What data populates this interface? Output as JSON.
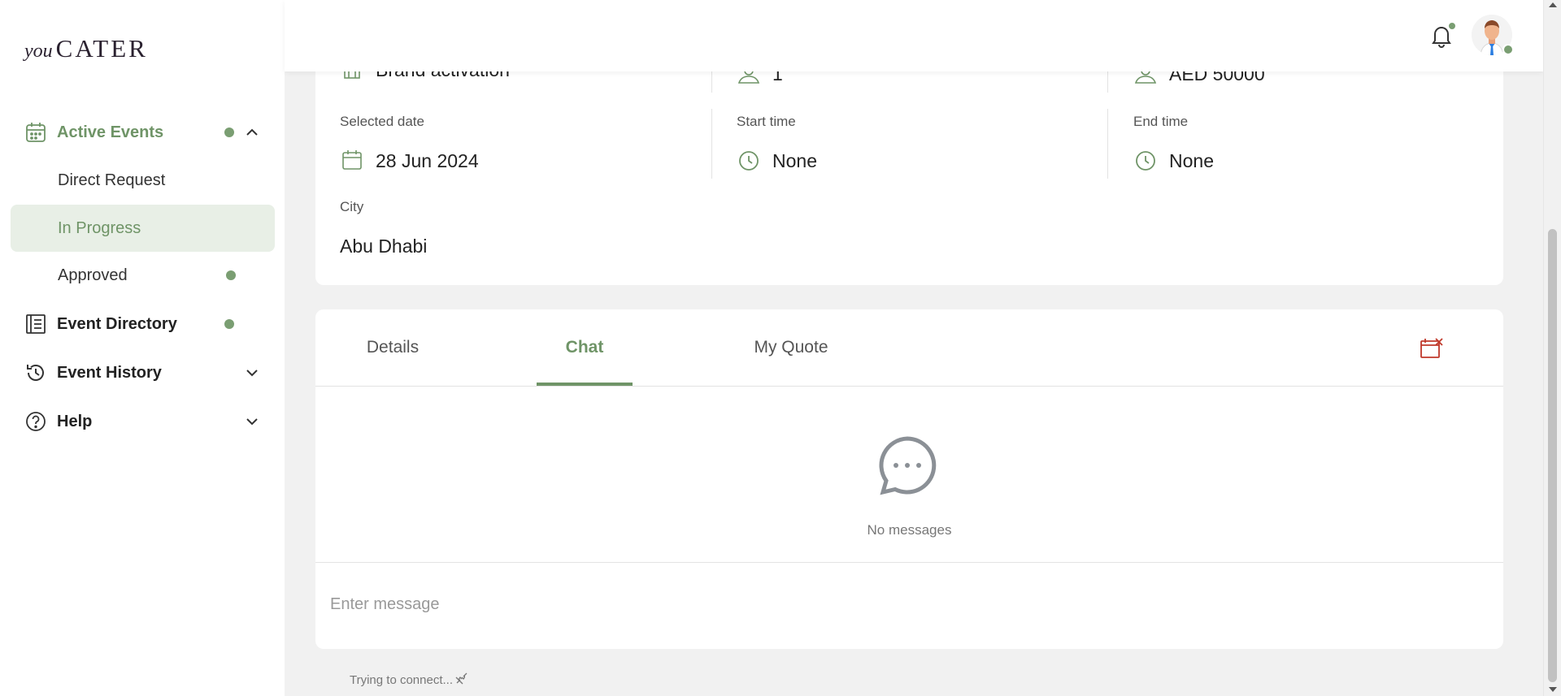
{
  "brand": {
    "prefix": "you",
    "name": "CATER"
  },
  "colors": {
    "accent": "#6f9467",
    "dot": "#7a9e72",
    "danger": "#c0392b",
    "selected_bg": "#e8efe6"
  },
  "sidebar": {
    "active_events": {
      "label": "Active Events",
      "icon": "calendar-icon"
    },
    "sub_items": [
      {
        "label": "Direct Request"
      },
      {
        "label": "In Progress"
      },
      {
        "label": "Approved"
      }
    ],
    "event_directory": {
      "label": "Event Directory",
      "icon": "directory-icon"
    },
    "event_history": {
      "label": "Event History",
      "icon": "history-icon"
    },
    "help": {
      "label": "Help",
      "icon": "help-icon"
    }
  },
  "event_info": {
    "event_type": {
      "value": "Brand activation"
    },
    "guests": {
      "value": "1"
    },
    "budget": {
      "value": "AED 50000"
    },
    "selected_date": {
      "label": "Selected date",
      "value": "28 Jun 2024"
    },
    "start_time": {
      "label": "Start time",
      "value": "None"
    },
    "end_time": {
      "label": "End time",
      "value": "None"
    },
    "city": {
      "label": "City",
      "value": "Abu Dhabi"
    }
  },
  "tabs": [
    {
      "label": "Details"
    },
    {
      "label": "Chat"
    },
    {
      "label": "My Quote"
    }
  ],
  "chat": {
    "empty_text": "No messages",
    "input_placeholder": "Enter message",
    "connection_status": "Trying to connect..."
  }
}
